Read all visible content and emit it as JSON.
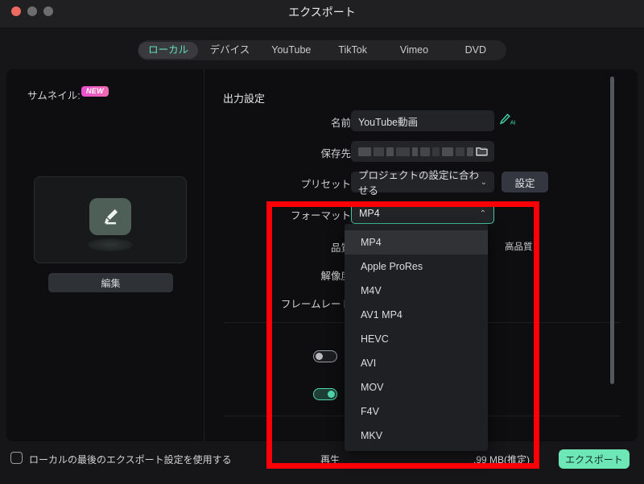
{
  "window": {
    "title": "エクスポート",
    "traffic_lights": [
      "close",
      "minimize",
      "maximize"
    ]
  },
  "tabs": [
    {
      "label": "ローカル",
      "active": true
    },
    {
      "label": "デバイス",
      "active": false
    },
    {
      "label": "YouTube",
      "active": false
    },
    {
      "label": "TikTok",
      "active": false
    },
    {
      "label": "Vimeo",
      "active": false
    },
    {
      "label": "DVD",
      "active": false
    }
  ],
  "left_panel": {
    "thumbnail_label": "サムネイル:",
    "new_badge": "NEW",
    "edit_button": "編集"
  },
  "output_settings": {
    "section_title": "出力設定",
    "name": {
      "label": "名前",
      "value": "YouTube動画",
      "ai_icon": "ai-pen-icon"
    },
    "save_to": {
      "label": "保存先",
      "value": "",
      "folder_icon": "folder-icon"
    },
    "preset": {
      "label": "プリセット",
      "value": "プロジェクトの設定に合わせる",
      "button": "設定"
    },
    "format": {
      "label": "フォーマット",
      "value": "MP4",
      "expanded": true
    },
    "quality": {
      "label": "品質",
      "high_label": "高品質"
    },
    "resolution": {
      "label": "解像度"
    },
    "framerate": {
      "label": "フレームレート"
    },
    "toggle_one": {
      "state": "off"
    },
    "toggle_two": {
      "state": "on"
    }
  },
  "format_dropdown": {
    "options": [
      "MP4",
      "Apple ProRes",
      "M4V",
      "AV1 MP4",
      "HEVC",
      "AVI",
      "MOV",
      "F4V",
      "MKV"
    ],
    "selected": "MP4"
  },
  "bottom_bar": {
    "checkbox_label": "ローカルの最後のエクスポート設定を使用する",
    "checkbox_checked": false,
    "play_label": "再生",
    "size_label": ".99 MB(推定)",
    "export_button": "エクスポート"
  },
  "colors": {
    "accent": "#46c9a0",
    "export_button": "#6ee7b7",
    "annotation": "#fb0007",
    "badge": "#e84fd0"
  }
}
